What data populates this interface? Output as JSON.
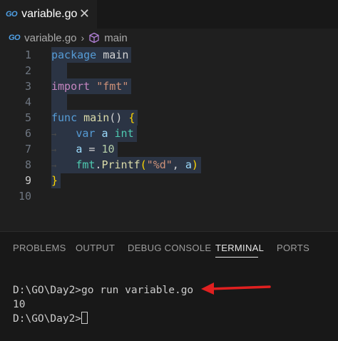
{
  "tab": {
    "icon_text": "GO",
    "label": "variable.go",
    "close": "✕"
  },
  "breadcrumb": {
    "file": "variable.go",
    "separator": "›",
    "symbol": "main"
  },
  "editor": {
    "line_numbers": [
      "1",
      "2",
      "3",
      "4",
      "5",
      "6",
      "7",
      "8",
      "9",
      "10"
    ],
    "active_line": "9",
    "code": {
      "l1_kw": "package",
      "l1_name": "main",
      "l3_kw": "import",
      "l3_str": "\"fmt\"",
      "l5_kw": "func",
      "l5_name": "main",
      "l5_rest": "()",
      "l5_brace": "{",
      "l6_kw": "var",
      "l6_var": "a",
      "l6_type": "int",
      "l7_var": "a",
      "l7_op": "=",
      "l7_num": "10",
      "l8_pkg": "fmt",
      "l8_dot": ".",
      "l8_fn": "Printf",
      "l8_open": "(",
      "l8_str": "\"%d\"",
      "l8_comma": ", ",
      "l8_arg": "a",
      "l8_close": ")",
      "l9_brace": "}"
    }
  },
  "panel": {
    "tabs": [
      "PROBLEMS",
      "OUTPUT",
      "DEBUG CONSOLE",
      "TERMINAL",
      "PORTS"
    ],
    "active_tab": "TERMINAL"
  },
  "terminal": {
    "lines": [
      "D:\\GO\\Day2>go run variable.go",
      "10",
      "D:\\GO\\Day2>"
    ]
  },
  "colors": {
    "arrow": "#e02020",
    "go_icon": "#4fa0e6",
    "cube_icon": "#b180d7"
  }
}
